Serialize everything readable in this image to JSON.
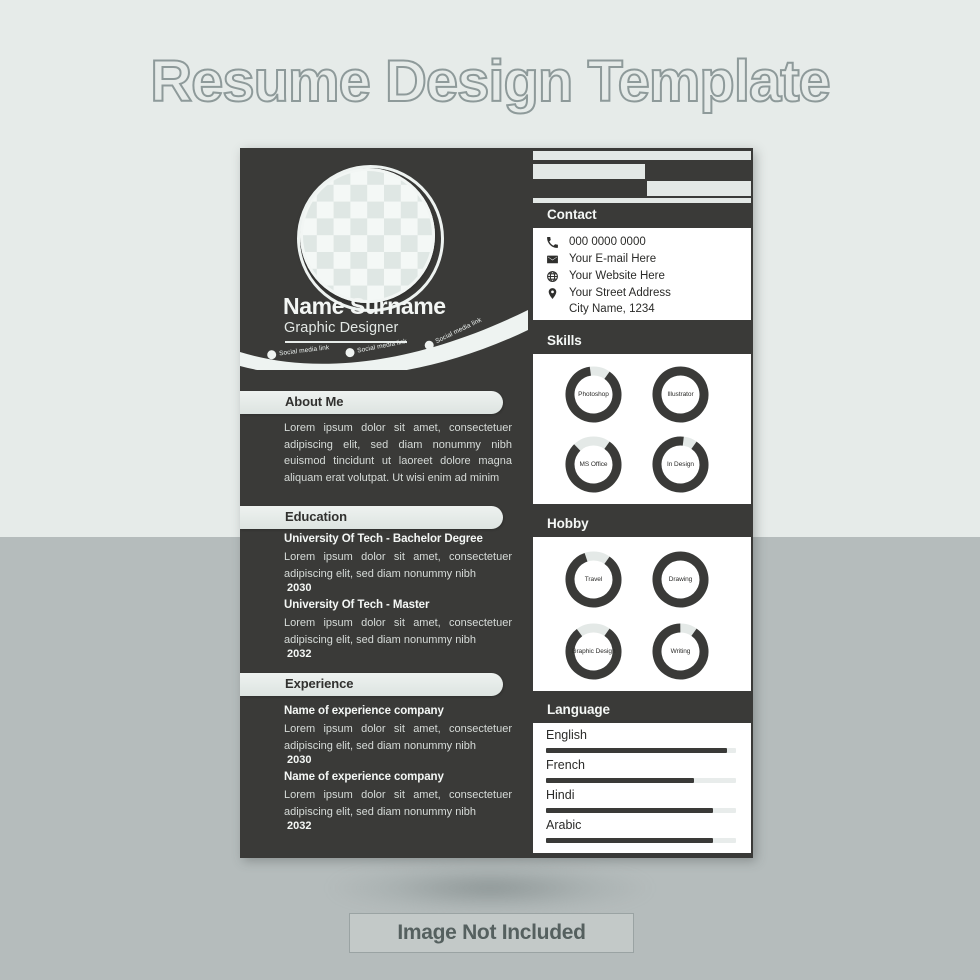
{
  "headline": "Resume Design Template",
  "footer_badge": "Image Not Included",
  "colors": {
    "bg_top": "#e6ebe9",
    "bg_bottom": "#b5bcbc",
    "dark": "#3a3a38",
    "panel": "#ffffff",
    "light_accent": "#e3e8e6",
    "muted_text": "#8e9a9a"
  },
  "profile": {
    "name": "Name Surname",
    "role": "Graphic Designer",
    "photo_placeholder": "checkerboard-photo-placeholder",
    "social_links": [
      {
        "label": "Social media link"
      },
      {
        "label": "Social media link"
      },
      {
        "label": "Social media link"
      }
    ]
  },
  "left": {
    "about": {
      "title": "About Me",
      "body": "Lorem ipsum dolor sit amet, consectetuer adipiscing elit, sed diam nonummy nibh euismod tincidunt ut laoreet dolore magna aliquam erat volutpat. Ut wisi enim ad minim"
    },
    "education": {
      "title": "Education",
      "items": [
        {
          "heading": "University Of Tech - Bachelor Degree",
          "body": "Lorem ipsum dolor sit amet, consectetuer adipiscing elit, sed diam nonummy nibh",
          "year": "2030"
        },
        {
          "heading": "University Of Tech - Master",
          "body": "Lorem ipsum dolor sit amet, consectetuer adipiscing elit, sed diam nonummy nibh",
          "year": "2032"
        }
      ]
    },
    "experience": {
      "title": "Experience",
      "items": [
        {
          "heading": "Name of experience company",
          "body": "Lorem ipsum dolor sit amet, consectetuer adipiscing elit, sed diam nonummy nibh",
          "year": "2030"
        },
        {
          "heading": "Name of experience company",
          "body": "Lorem ipsum dolor sit amet, consectetuer adipiscing elit, sed diam nonummy nibh",
          "year": "2032"
        }
      ]
    }
  },
  "right": {
    "contact": {
      "title": "Contact",
      "items": [
        {
          "icon": "phone-icon",
          "text": "000 0000 0000"
        },
        {
          "icon": "envelope-icon",
          "text": "Your E-mail Here"
        },
        {
          "icon": "globe-icon",
          "text": "Your Website Here"
        },
        {
          "icon": "location-pin-icon",
          "text": "Your Street Address"
        }
      ],
      "address_line2": "City Name, 1234"
    },
    "skills": {
      "title": "Skills",
      "items": [
        {
          "label": "Photoshop",
          "percent": 88
        },
        {
          "label": "Illustrator",
          "percent": 100
        },
        {
          "label": "MS Office",
          "percent": 78
        },
        {
          "label": "In Design",
          "percent": 92
        }
      ]
    },
    "hobby": {
      "title": "Hobby",
      "items": [
        {
          "label": "Travel",
          "percent": 85
        },
        {
          "label": "Drawing",
          "percent": 100
        },
        {
          "label": "Graphic Design",
          "percent": 80
        },
        {
          "label": "Writing",
          "percent": 90
        }
      ]
    },
    "language": {
      "title": "Language",
      "items": [
        {
          "label": "English",
          "percent": 95
        },
        {
          "label": "French",
          "percent": 78
        },
        {
          "label": "Hindi",
          "percent": 88
        },
        {
          "label": "Arabic",
          "percent": 88
        }
      ]
    }
  }
}
